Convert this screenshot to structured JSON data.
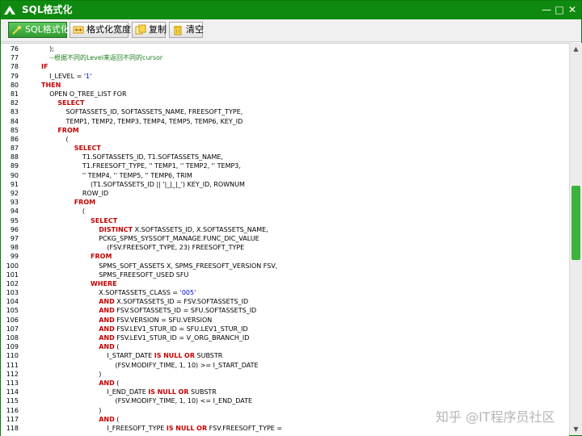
{
  "window": {
    "title": "SQL格式化"
  },
  "toolbar": {
    "buttons": [
      {
        "label": "SQL格式化"
      },
      {
        "label": "格式化宽度"
      },
      {
        "label": "复制"
      },
      {
        "label": "清空"
      }
    ]
  },
  "editor": {
    "lines": [
      {
        "n": "76",
        "t": "        );"
      },
      {
        "n": "77",
        "t": "        --根据不同的Level来返回不同的cursor"
      },
      {
        "n": "78",
        "t": "    IF"
      },
      {
        "n": "79",
        "t": "        I_LEVEL = '1'"
      },
      {
        "n": "80",
        "t": "    THEN"
      },
      {
        "n": "81",
        "t": "        OPEN O_TREE_LIST FOR"
      },
      {
        "n": "82",
        "t": "            SELECT"
      },
      {
        "n": "83",
        "t": "                SOFTASSETS_ID, SOFTASSETS_NAME, FREESOFT_TYPE,"
      },
      {
        "n": "84",
        "t": "                TEMP1, TEMP2, TEMP3, TEMP4, TEMP5, TEMP6, KEY_ID"
      },
      {
        "n": "85",
        "t": "            FROM"
      },
      {
        "n": "86",
        "t": "                ("
      },
      {
        "n": "87",
        "t": "                    SELECT"
      },
      {
        "n": "88",
        "t": "                        T1.SOFTASSETS_ID, T1.SOFTASSETS_NAME,"
      },
      {
        "n": "89",
        "t": "                        T1.FREESOFT_TYPE, '' TEMP1, '' TEMP2, '' TEMP3,"
      },
      {
        "n": "90",
        "t": "                        '' TEMP4, '' TEMP5, '' TEMP6, TRIM"
      },
      {
        "n": "91",
        "t": "                            (T1.SOFTASSETS_ID || '|_|_|_') KEY_ID, ROWNUM"
      },
      {
        "n": "92",
        "t": "                        ROW_ID"
      },
      {
        "n": "93",
        "t": "                    FROM"
      },
      {
        "n": "94",
        "t": "                        ("
      },
      {
        "n": "95",
        "t": "                            SELECT"
      },
      {
        "n": "96",
        "t": "                                DISTINCT X.SOFTASSETS_ID, X.SOFTASSETS_NAME,"
      },
      {
        "n": "97",
        "t": "                                PCKG_SPMS_SYSSOFT_MANAGE.FUNC_DIC_VALUE"
      },
      {
        "n": "98",
        "t": "                                    (FSV.FREESOFT_TYPE, 23) FREESOFT_TYPE"
      },
      {
        "n": "99",
        "t": "                            FROM"
      },
      {
        "n": "100",
        "t": "                                SPMS_SOFT_ASSETS X, SPMS_FREESOFT_VERSION FSV,"
      },
      {
        "n": "101",
        "t": "                                SPMS_FREESOFT_USED SFU"
      },
      {
        "n": "102",
        "t": "                            WHERE"
      },
      {
        "n": "103",
        "t": "                                X.SOFTASSETS_CLASS = '005'"
      },
      {
        "n": "104",
        "t": "                                AND X.SOFTASSETS_ID = FSV.SOFTASSETS_ID"
      },
      {
        "n": "105",
        "t": "                                AND FSV.SOFTASSETS_ID = SFU.SOFTASSETS_ID"
      },
      {
        "n": "106",
        "t": "                                AND FSV.VERSION = SFU.VERSION"
      },
      {
        "n": "107",
        "t": "                                AND FSV.LEV1_STUR_ID = SFU.LEV1_STUR_ID"
      },
      {
        "n": "108",
        "t": "                                AND FSV.LEV1_STUR_ID = V_ORG_BRANCH_ID"
      },
      {
        "n": "109",
        "t": "                                AND ("
      },
      {
        "n": "110",
        "t": "                                    I_START_DATE IS NULL OR SUBSTR"
      },
      {
        "n": "111",
        "t": "                                        (FSV.MODIFY_TIME, 1, 10) >= I_START_DATE"
      },
      {
        "n": "112",
        "t": "                                )"
      },
      {
        "n": "113",
        "t": "                                AND ("
      },
      {
        "n": "114",
        "t": "                                    I_END_DATE IS NULL OR SUBSTR"
      },
      {
        "n": "115",
        "t": "                                        (FSV.MODIFY_TIME, 1, 10) <= I_END_DATE"
      },
      {
        "n": "116",
        "t": "                                )"
      },
      {
        "n": "117",
        "t": "                                AND ("
      },
      {
        "n": "118",
        "t": "                                    I_FREESOFT_TYPE IS NULL OR FSV.FREESOFT_TYPE ="
      }
    ]
  },
  "watermark": {
    "text": "知乎 @IT程序员社区"
  },
  "colors": {
    "titlebar": "#0f8a10",
    "keyword": "#c40000",
    "comment": "#1e7f1e",
    "string": "#0000c8",
    "scroll_thumb": "#3db33d"
  },
  "icons": [
    "app-logo-icon",
    "minimize-icon",
    "maximize-icon",
    "close-icon",
    "magic-wand-icon",
    "width-icon",
    "copy-icon",
    "trash-icon",
    "scroll-up-icon",
    "scroll-down-icon"
  ]
}
